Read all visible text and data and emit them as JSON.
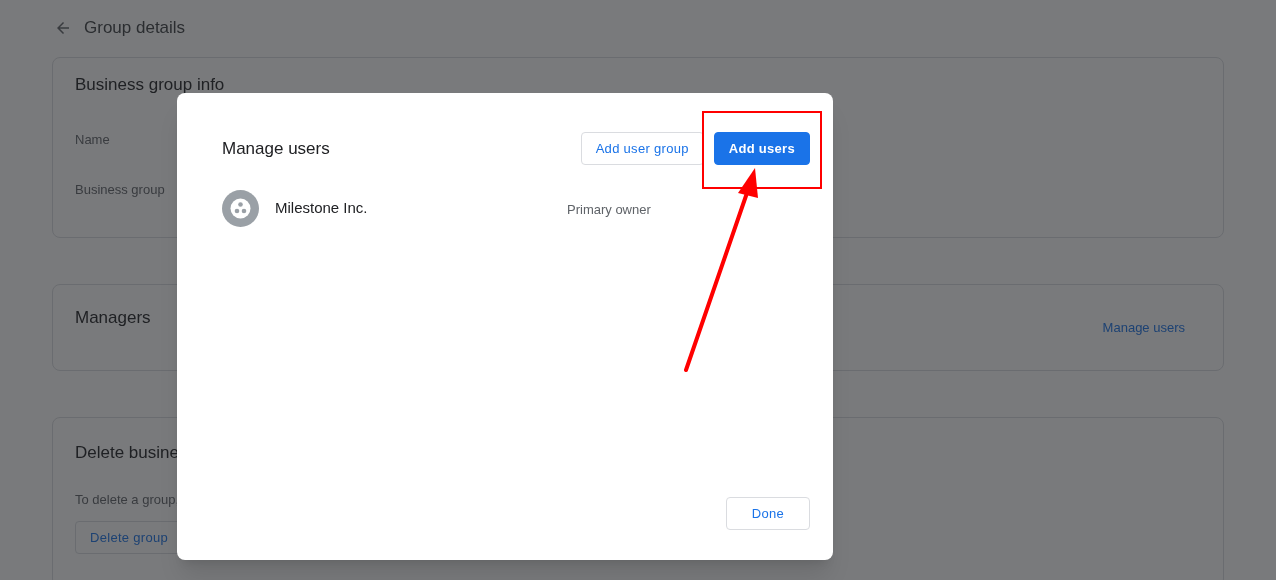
{
  "page": {
    "title": "Group details",
    "info_card": {
      "title": "Business group info",
      "fields": [
        "Name",
        "Business group"
      ]
    },
    "managers_card": {
      "title": "Managers",
      "link": "Manage users"
    },
    "delete_card": {
      "title": "Delete busine",
      "text": "To delete a group,",
      "button": "Delete group"
    }
  },
  "dialog": {
    "title": "Manage users",
    "buttons": [
      {
        "label": "Add user group",
        "kind": "outlined"
      },
      {
        "label": "Add users",
        "kind": "filled"
      }
    ],
    "users": [
      {
        "name": "Milestone Inc.",
        "role": "Primary owner"
      }
    ],
    "footer_button": "Done"
  }
}
